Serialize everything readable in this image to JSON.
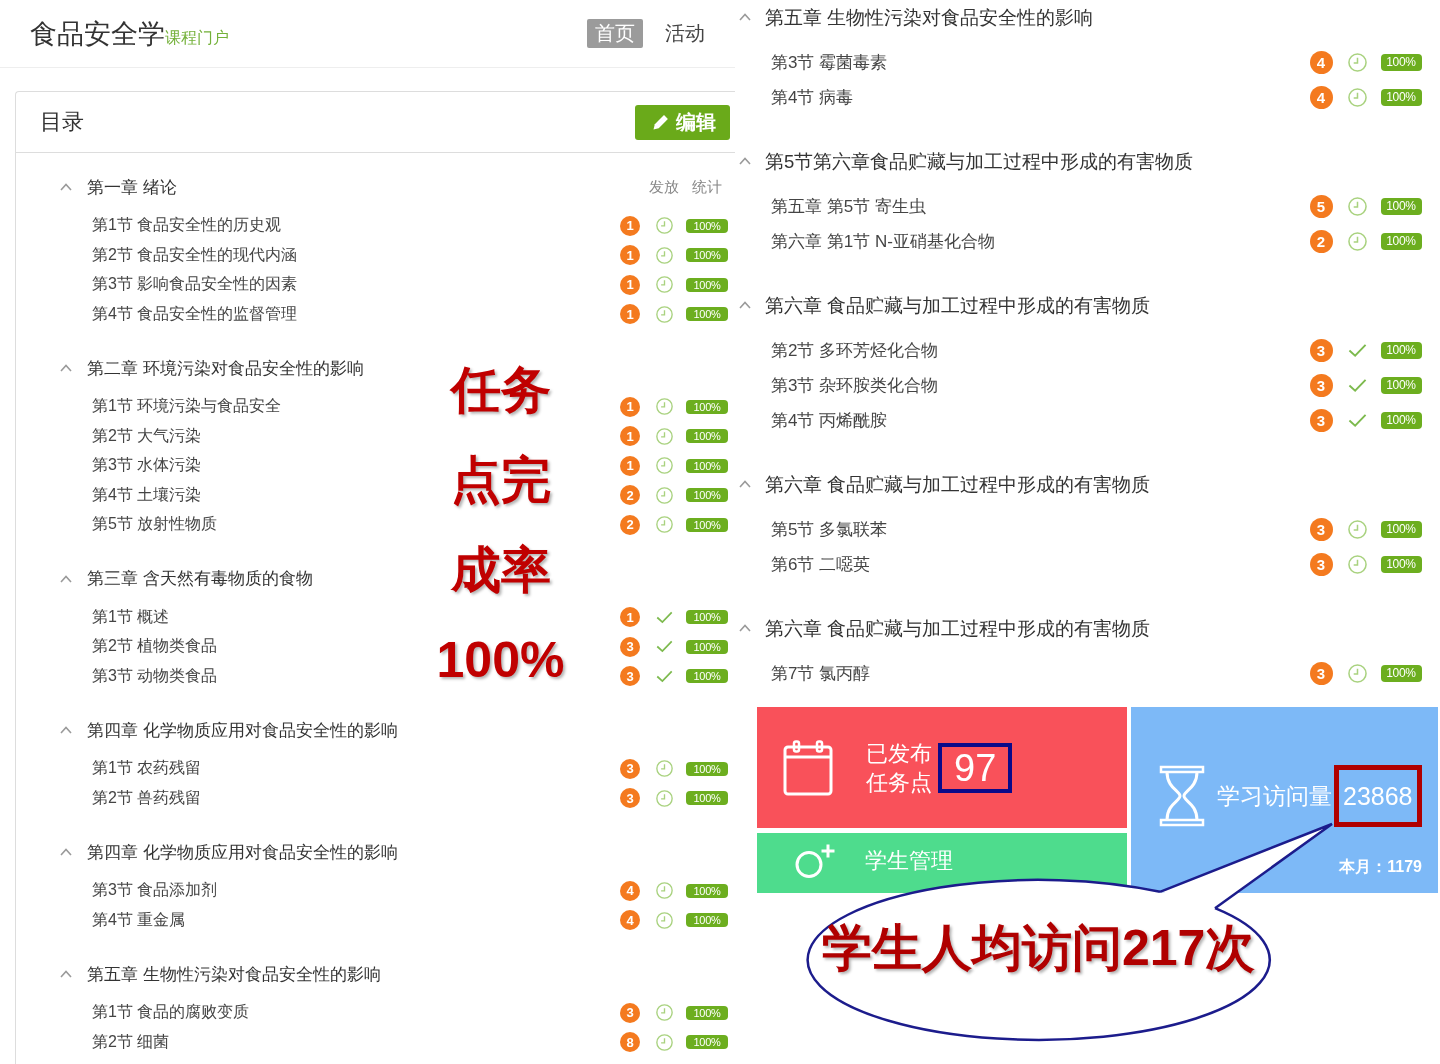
{
  "course_header": {
    "title": "食品安全学",
    "subtitle": "课程门户",
    "tabs": [
      {
        "label": "首页",
        "selected": true
      },
      {
        "label": "活动",
        "selected": false
      }
    ]
  },
  "catalog": {
    "title": "目录",
    "edit_button": "编辑",
    "column_headers": [
      "发放",
      "统计"
    ],
    "chapters": [
      {
        "title": "第一章 绪论",
        "expanded": true,
        "children": [
          {
            "title": "第1节 食品安全性的历史观",
            "count": "1",
            "completed": false,
            "rate": "100%"
          },
          {
            "title": "第2节 食品安全性的现代内涵",
            "count": "1",
            "completed": false,
            "rate": "100%"
          },
          {
            "title": "第3节 影响食品安全性的因素",
            "count": "1",
            "completed": false,
            "rate": "100%"
          },
          {
            "title": "第4节 食品安全性的监督管理",
            "count": "1",
            "completed": false,
            "rate": "100%"
          }
        ]
      },
      {
        "title": "第二章 环境污染对食品安全性的影响",
        "expanded": true,
        "children": [
          {
            "title": "第1节 环境污染与食品安全",
            "count": "1",
            "completed": false,
            "rate": "100%"
          },
          {
            "title": "第2节 大气污染",
            "count": "1",
            "completed": false,
            "rate": "100%"
          },
          {
            "title": "第3节 水体污染",
            "count": "1",
            "completed": false,
            "rate": "100%"
          },
          {
            "title": "第4节 土壤污染",
            "count": "2",
            "completed": false,
            "rate": "100%"
          },
          {
            "title": "第5节 放射性物质",
            "count": "2",
            "completed": false,
            "rate": "100%"
          }
        ]
      },
      {
        "title": "第三章 含天然有毒物质的食物",
        "expanded": true,
        "children": [
          {
            "title": "第1节 概述",
            "count": "1",
            "completed": true,
            "rate": "100%"
          },
          {
            "title": "第2节 植物类食品",
            "count": "3",
            "completed": true,
            "rate": "100%"
          },
          {
            "title": "第3节 动物类食品",
            "count": "3",
            "completed": true,
            "rate": "100%"
          }
        ]
      },
      {
        "title": "第四章 化学物质应用对食品安全性的影响",
        "expanded": true,
        "children": [
          {
            "title": "第1节 农药残留",
            "count": "3",
            "completed": false,
            "rate": "100%"
          },
          {
            "title": "第2节 兽药残留",
            "count": "3",
            "completed": false,
            "rate": "100%"
          }
        ]
      },
      {
        "title": "第四章 化学物质应用对食品安全性的影响",
        "expanded": true,
        "children": [
          {
            "title": "第3节 食品添加剂",
            "count": "4",
            "completed": false,
            "rate": "100%"
          },
          {
            "title": "第4节 重金属",
            "count": "4",
            "completed": false,
            "rate": "100%"
          }
        ]
      },
      {
        "title": "第五章 生物性污染对食品安全性的影响",
        "expanded": true,
        "children": [
          {
            "title": "第1节 食品的腐败变质",
            "count": "3",
            "completed": false,
            "rate": "100%"
          },
          {
            "title": "第2节 细菌",
            "count": "8",
            "completed": false,
            "rate": "100%"
          }
        ]
      }
    ]
  },
  "catalog_continued": {
    "chapters": [
      {
        "title": "第五章 生物性污染对食品安全性的影响",
        "expanded": true,
        "children": [
          {
            "title": "第3节 霉菌毒素",
            "count": "4",
            "completed": false,
            "rate": "100%"
          },
          {
            "title": "第4节 病毒",
            "count": "4",
            "completed": false,
            "rate": "100%"
          }
        ]
      },
      {
        "title": "第5节第六章食品贮藏与加工过程中形成的有害物质",
        "expanded": true,
        "children": [
          {
            "title": "第五章 第5节 寄生虫",
            "count": "5",
            "completed": false,
            "rate": "100%"
          },
          {
            "title": "第六章 第1节 N-亚硝基化合物",
            "count": "2",
            "completed": false,
            "rate": "100%"
          }
        ]
      },
      {
        "title": "第六章 食品贮藏与加工过程中形成的有害物质",
        "expanded": true,
        "children": [
          {
            "title": "第2节 多环芳烃化合物",
            "count": "3",
            "completed": true,
            "rate": "100%"
          },
          {
            "title": "第3节 杂环胺类化合物",
            "count": "3",
            "completed": true,
            "rate": "100%"
          },
          {
            "title": "第4节 丙烯酰胺",
            "count": "3",
            "completed": true,
            "rate": "100%"
          }
        ]
      },
      {
        "title": "第六章 食品贮藏与加工过程中形成的有害物质",
        "expanded": true,
        "children": [
          {
            "title": "第5节 多氯联苯",
            "count": "3",
            "completed": false,
            "rate": "100%"
          },
          {
            "title": "第6节 二噁英",
            "count": "3",
            "completed": false,
            "rate": "100%"
          }
        ]
      },
      {
        "title": "第六章 食品贮藏与加工过程中形成的有害物质",
        "expanded": true,
        "children": [
          {
            "title": "第7节 氯丙醇",
            "count": "3",
            "completed": false,
            "rate": "100%"
          }
        ]
      }
    ]
  },
  "stat_tiles": [
    {
      "kind": "tasks",
      "color": "#f9515a",
      "label_lines": [
        "已发布",
        "任务点"
      ],
      "value": "97",
      "highlighted": true
    },
    {
      "kind": "students",
      "color": "#4edc8d",
      "label": "学生管理"
    },
    {
      "kind": "visits",
      "color": "#7db9f7",
      "label": "学习访问量",
      "value": "23868",
      "highlighted": true,
      "footer": "本月：1179"
    }
  ],
  "annotations": {
    "completion_note": [
      "任务",
      "点完",
      "成率",
      "100%"
    ],
    "callout": "学生人均访问217次"
  }
}
